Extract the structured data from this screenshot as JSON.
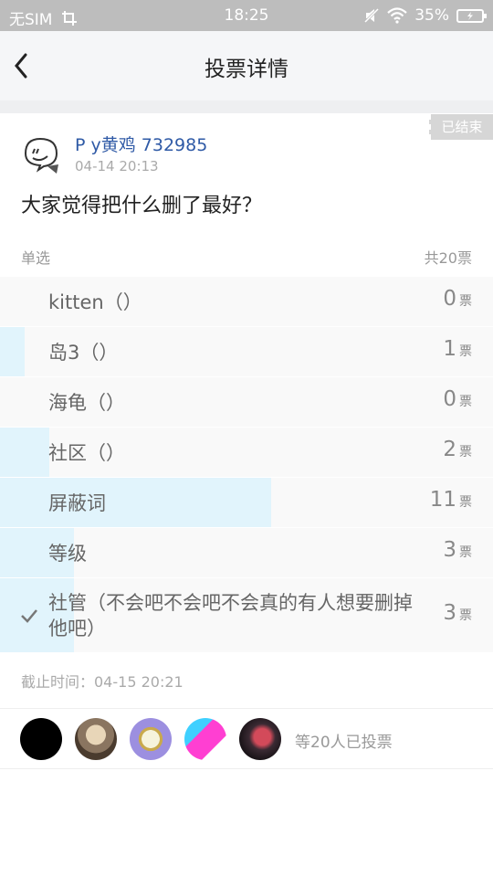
{
  "status_bar": {
    "carrier": "无SIM",
    "time": "18:25",
    "battery": "35%"
  },
  "nav": {
    "title": "投票详情"
  },
  "poll": {
    "status_badge": "已结束",
    "poster_name": "P y黄鸡 732985",
    "post_time": "04-14 20:13",
    "question": "大家觉得把什么删了最好？",
    "vote_type": "单选",
    "total_votes": "共20票",
    "vote_unit": "票",
    "options": [
      {
        "label": "kitten（）",
        "count": "0",
        "share": 0.0,
        "selected": false
      },
      {
        "label": "岛3（）",
        "count": "1",
        "share": 0.05,
        "selected": false
      },
      {
        "label": "海龟（）",
        "count": "0",
        "share": 0.0,
        "selected": false
      },
      {
        "label": "社区（）",
        "count": "2",
        "share": 0.1,
        "selected": false
      },
      {
        "label": "屏蔽词",
        "count": "11",
        "share": 0.55,
        "selected": false
      },
      {
        "label": "等级",
        "count": "3",
        "share": 0.15,
        "selected": false
      },
      {
        "label": "社管（不会吧不会吧不会真的有人想要删掉他吧）",
        "count": "3",
        "share": 0.15,
        "selected": true
      }
    ],
    "deadline": "截止时间：04-15 20:21",
    "voters_summary": "等20人已投票"
  },
  "colors": {
    "accent_blue": "#2f5aa6",
    "bar_fill": "#e1f4fc",
    "status_bar": "#bdbdbd"
  }
}
